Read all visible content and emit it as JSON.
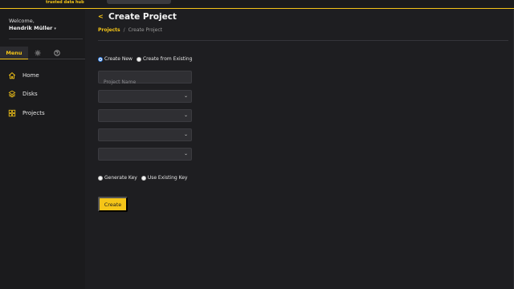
{
  "header": {
    "tagline": "trusted data hub"
  },
  "sidebar": {
    "welcome": "Welcome,",
    "user_name": "Hendrik Müller",
    "tabs": {
      "menu_label": "Menu"
    },
    "items": [
      {
        "label": "Home",
        "icon": "home-icon"
      },
      {
        "label": "Disks",
        "icon": "layers-icon"
      },
      {
        "label": "Projects",
        "icon": "grid-icon"
      }
    ]
  },
  "main": {
    "back_symbol": "<",
    "title": "Create Project",
    "breadcrumb": {
      "link": "Projects",
      "separator": "/",
      "current": "Create Project"
    },
    "mode_options": [
      {
        "label": "Create New",
        "checked": true
      },
      {
        "label": "Create from Existing",
        "checked": false
      }
    ],
    "project_name_placeholder": "Project Name",
    "selects": [
      "",
      "",
      "",
      ""
    ],
    "key_options": [
      {
        "label": "Generate Key",
        "checked": false
      },
      {
        "label": "Use Existing Key",
        "checked": false
      }
    ],
    "create_label": "Create"
  },
  "colors": {
    "accent": "#f5c518",
    "background": "#1e1e21",
    "sidebar": "#1b1b1d",
    "field": "#2f2f33"
  }
}
